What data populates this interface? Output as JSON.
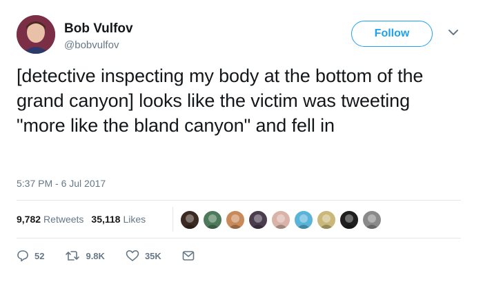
{
  "user": {
    "name": "Bob Vulfov",
    "handle": "@bobvulfov"
  },
  "follow_button": {
    "label": "Follow"
  },
  "tweet": {
    "text": "[detective inspecting my body at the bottom of the grand canyon] looks like the victim was tweeting \"more like the bland canyon\" and fell in",
    "timestamp": "5:37 PM - 6 Jul 2017"
  },
  "stats": {
    "retweets_count": "9,782",
    "retweets_label": "Retweets",
    "likes_count": "35,118",
    "likes_label": "Likes"
  },
  "liker_avatars": [
    {
      "color": "#3b2a22"
    },
    {
      "color": "#4d7a5a"
    },
    {
      "color": "#c98a5a"
    },
    {
      "color": "#4a3d4e"
    },
    {
      "color": "#d9b3a8"
    },
    {
      "color": "#5ab4d9"
    },
    {
      "color": "#c9b87a"
    },
    {
      "color": "#1f1f1f"
    },
    {
      "color": "#8a8a8a"
    }
  ],
  "actions": {
    "reply_count": "52",
    "retweet_count": "9.8K",
    "like_count": "35K"
  },
  "colors": {
    "accent": "#1da1f2",
    "text": "#14171a",
    "muted": "#657786",
    "divider": "#e1e8ed"
  },
  "icons": [
    "reply-icon",
    "retweet-icon",
    "heart-icon",
    "message-icon",
    "chevron-down-icon"
  ]
}
